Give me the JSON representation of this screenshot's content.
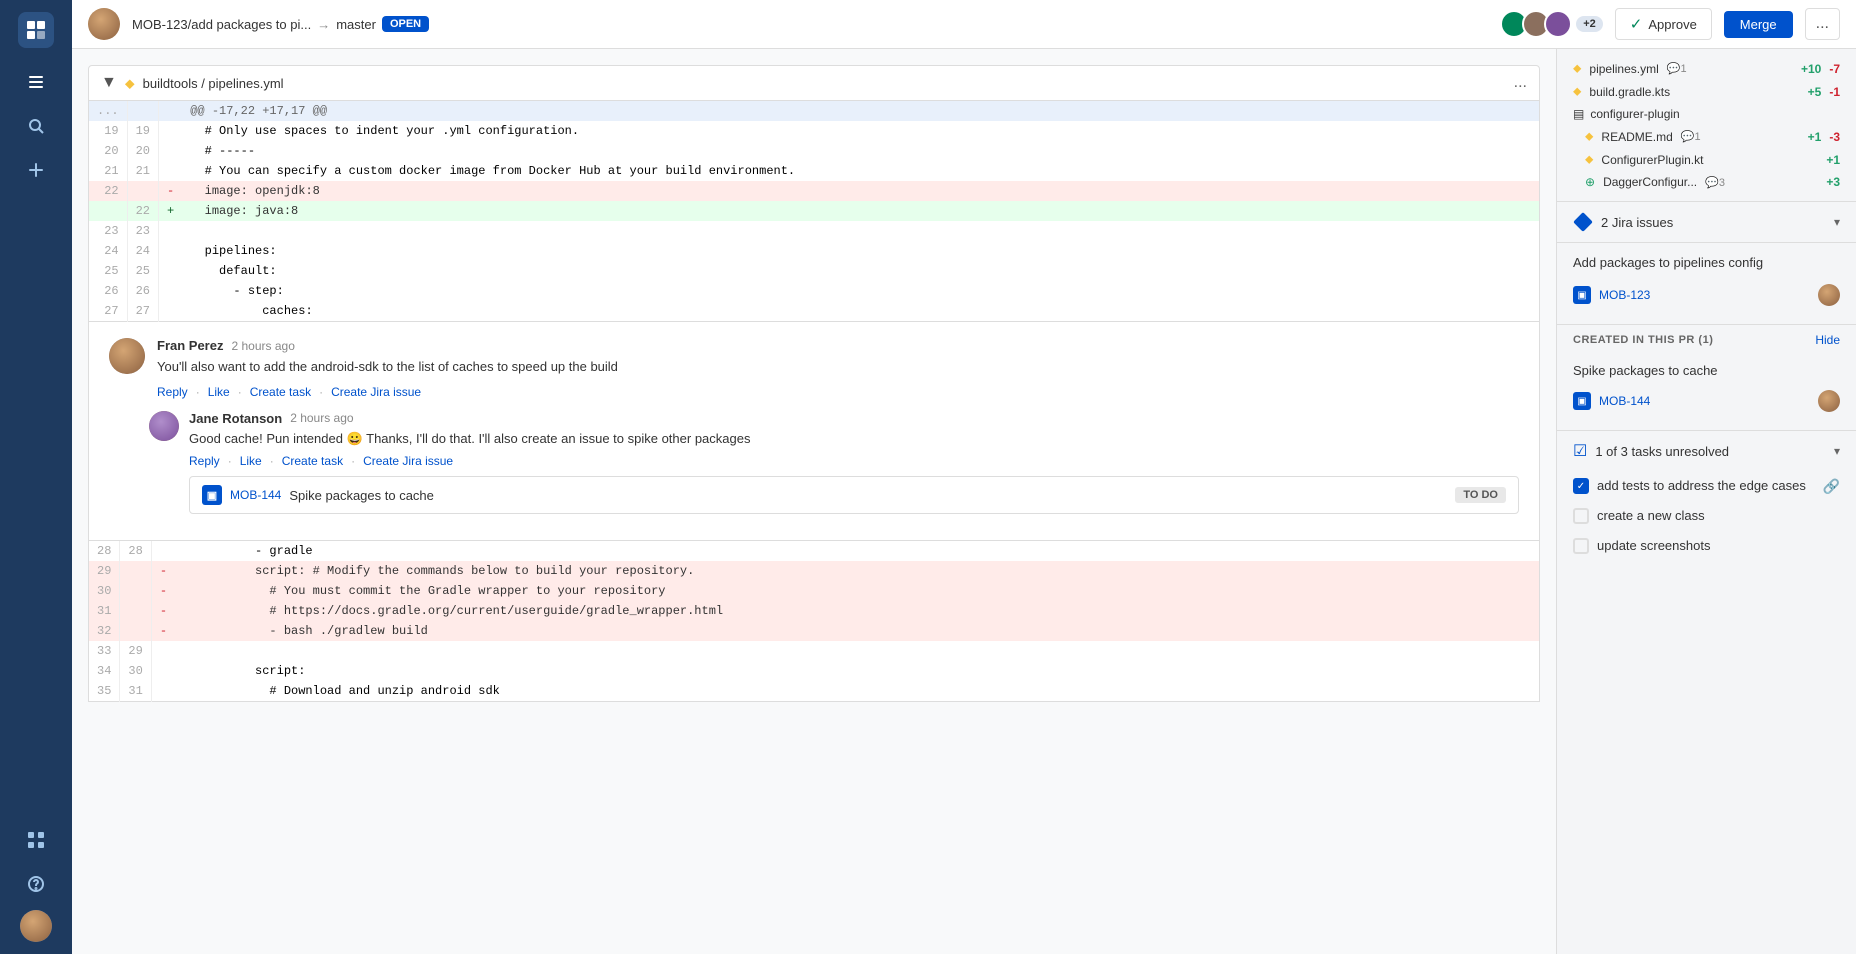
{
  "sidebar": {
    "logo": "⊓",
    "icons": [
      "≡",
      "⌕",
      "+",
      "⊞",
      "?"
    ],
    "avatar_label": "User avatar"
  },
  "topbar": {
    "branch": "MOB-123/add packages to pi...",
    "arrow": "→",
    "target": "master",
    "status": "OPEN",
    "plus_count": "+2",
    "approve_label": "Approve",
    "merge_label": "Merge",
    "more_label": "..."
  },
  "file_header": {
    "path": "buildtools / pipelines.yml",
    "more": "..."
  },
  "diff": {
    "hunk": "@@ -17,22 +17,17 @@",
    "lines": [
      {
        "ln_old": "19",
        "ln_new": "19",
        "sign": " ",
        "content": "  # Only use spaces to indent your .yml configuration.",
        "type": "context"
      },
      {
        "ln_old": "20",
        "ln_new": "20",
        "sign": " ",
        "content": "  # -----",
        "type": "context"
      },
      {
        "ln_old": "21",
        "ln_new": "21",
        "sign": " ",
        "content": "  # You can specify a custom docker image from Docker Hub at your build environment.",
        "type": "context"
      },
      {
        "ln_old": "22",
        "ln_new": "",
        "sign": "-",
        "content": "  image: openjdk:8",
        "type": "removed"
      },
      {
        "ln_old": "",
        "ln_new": "22",
        "sign": "+",
        "content": "  image: java:8",
        "type": "added"
      },
      {
        "ln_old": "23",
        "ln_new": "23",
        "sign": " ",
        "content": "",
        "type": "context"
      },
      {
        "ln_old": "24",
        "ln_new": "24",
        "sign": " ",
        "content": "  pipelines:",
        "type": "context"
      },
      {
        "ln_old": "25",
        "ln_new": "25",
        "sign": " ",
        "content": "    default:",
        "type": "context"
      },
      {
        "ln_old": "26",
        "ln_new": "26",
        "sign": " ",
        "content": "      - step:",
        "type": "context"
      },
      {
        "ln_old": "27",
        "ln_new": "27",
        "sign": " ",
        "content": "          caches:",
        "type": "context"
      }
    ],
    "lines_after": [
      {
        "ln_old": "28",
        "ln_new": "28",
        "sign": " ",
        "content": "          - gradle",
        "type": "context"
      },
      {
        "ln_old": "29",
        "ln_new": "",
        "sign": "-",
        "content": "          script: # Modify the commands below to build your repository.",
        "type": "removed"
      },
      {
        "ln_old": "30",
        "ln_new": "",
        "sign": "-",
        "content": "            # You must commit the Gradle wrapper to your repository",
        "type": "removed"
      },
      {
        "ln_old": "31",
        "ln_new": "",
        "sign": "-",
        "content": "            # https://docs.gradle.org/current/userguide/gradle_wrapper.html",
        "type": "removed"
      },
      {
        "ln_old": "32",
        "ln_new": "",
        "sign": "-",
        "content": "            - bash ./gradlew build",
        "type": "removed"
      },
      {
        "ln_old": "33",
        "ln_new": "29",
        "sign": " ",
        "content": "",
        "type": "context"
      },
      {
        "ln_old": "34",
        "ln_new": "30",
        "sign": " ",
        "content": "          script:",
        "type": "context"
      },
      {
        "ln_old": "35",
        "ln_new": "31",
        "sign": " ",
        "content": "            # Download and unzip android sdk",
        "type": "context"
      }
    ]
  },
  "comment": {
    "author": "Fran Perez",
    "time": "2 hours ago",
    "text": "You'll also want to add the android-sdk to the list of caches to speed up the build",
    "actions": [
      "Reply",
      "Like",
      "Create task",
      "Create Jira issue"
    ]
  },
  "reply": {
    "author": "Jane Rotanson",
    "time": "2 hours ago",
    "text": "Good cache! Pun intended 😀 Thanks, I'll do that. I'll also create an issue to spike other packages",
    "actions": [
      "Reply",
      "Like",
      "Create task",
      "Create Jira issue"
    ],
    "jira_card": {
      "issue_id": "MOB-144",
      "title": "Spike packages to cache",
      "status": "TO DO"
    }
  },
  "right_panel": {
    "files": [
      {
        "icon": "yellow",
        "name": "pipelines.yml",
        "comment_count": "1",
        "stat_add": "+10",
        "stat_rem": "-7"
      },
      {
        "icon": "yellow",
        "name": "build.gradle.kts",
        "comment_count": null,
        "stat_add": "+5",
        "stat_rem": "-1"
      }
    ],
    "folder": {
      "name": "configurer-plugin",
      "files": [
        {
          "icon": "yellow",
          "name": "README.md",
          "comment_count": "1",
          "stat_add": "+1",
          "stat_rem": "-3"
        },
        {
          "icon": "yellow",
          "name": "ConfigurerPlugin.kt",
          "comment_count": null,
          "stat_add": "+1",
          "stat_rem": null
        },
        {
          "icon": "green",
          "name": "DaggerConfigur...",
          "comment_count": "3",
          "stat_add": "+3",
          "stat_rem": null
        }
      ]
    },
    "jira": {
      "section_title": "2 Jira issues",
      "pr_title": "Add packages to pipelines config",
      "issue_id": "MOB-123"
    },
    "created_in_pr": {
      "label": "CREATED IN THIS PR (1)",
      "hide_label": "Hide",
      "spike_title": "Spike packages to cache",
      "spike_issue_id": "MOB-144"
    },
    "tasks": {
      "title": "1 of 3 tasks unresolved",
      "items": [
        {
          "text": "add tests to address the edge cases",
          "checked": true,
          "has_link": true
        },
        {
          "text": "create a new class",
          "checked": false,
          "has_link": false
        },
        {
          "text": "update screenshots",
          "checked": false,
          "has_link": false
        }
      ]
    }
  }
}
